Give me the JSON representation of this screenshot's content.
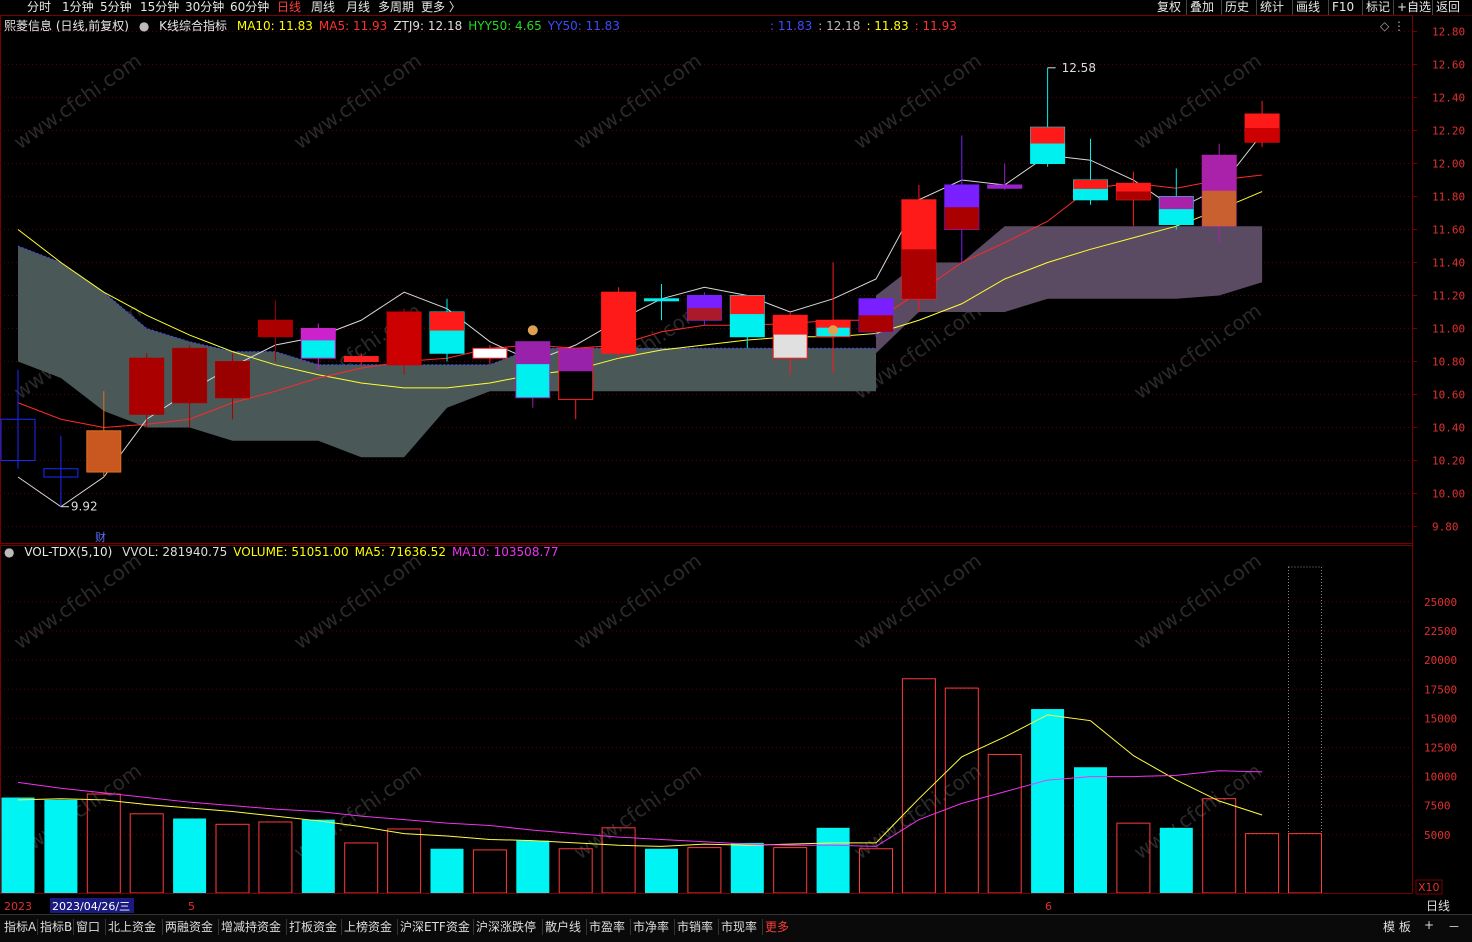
{
  "toolbar": {
    "periods": [
      "分时",
      "1分钟",
      "5分钟",
      "15分钟",
      "30分钟",
      "60分钟",
      "日线",
      "周线",
      "月线",
      "多周期",
      "更多 〉"
    ],
    "active_period": "日线",
    "tools": [
      "复权",
      "叠加",
      "历史",
      "统计",
      "画线",
      "F10",
      "标记",
      "+自选",
      "返回"
    ]
  },
  "main_legend": {
    "stock": "熙菱信息 (日线,前复权)",
    "indicator": "K线综合指标",
    "items": [
      {
        "label": "MA10: 11.83",
        "color": "#ffff00"
      },
      {
        "label": "MA5: 11.93",
        "color": "#ff3030"
      },
      {
        "label": "ZTJ9: 12.18",
        "color": "#dddddd"
      },
      {
        "label": "HYY50: 4.65",
        "color": "#22dd22"
      },
      {
        "label": "YY50: 11.83",
        "color": "#3a4cff"
      }
    ],
    "center_values": [
      {
        "label": ": 11.83",
        "color": "#3a4cff"
      },
      {
        "label": ": 12.18",
        "color": "#bbbbbb"
      },
      {
        "label": ": 11.83",
        "color": "#ffff00"
      },
      {
        "label": ": 11.93",
        "color": "#ff3030"
      }
    ],
    "high_label": "12.58",
    "low_label": "9.92",
    "marker_label": "财"
  },
  "vol_legend": {
    "name": "VOL-TDX(5,10)",
    "items": [
      {
        "label": "VVOL: 281940.75",
        "color": "#dddddd"
      },
      {
        "label": "VOLUME: 51051.00",
        "color": "#ffff00"
      },
      {
        "label": "MA5: 71636.52",
        "color": "#ffff00"
      },
      {
        "label": "MA10: 103508.77",
        "color": "#ee33ee"
      }
    ]
  },
  "price_axis": [
    "12.80",
    "12.60",
    "12.40",
    "12.20",
    "12.00",
    "11.80",
    "11.60",
    "11.40",
    "11.20",
    "11.00",
    "10.80",
    "10.60",
    "10.40",
    "10.20",
    "10.00",
    "9.80"
  ],
  "volume_axis": [
    "25000",
    "22500",
    "20000",
    "17500",
    "15000",
    "12500",
    "10000",
    "7500",
    "5000"
  ],
  "volume_unit": "X10",
  "time_axis": {
    "year": "2023",
    "date": "2023/04/26/三",
    "month5": "5",
    "month6": "6",
    "period": "日线"
  },
  "bottom_tabs": [
    "指标A",
    "指标B",
    "窗口",
    "北上资金",
    "两融资金",
    "增减持资金",
    "打板资金",
    "上榜资金",
    "沪深ETF资金",
    "沪深涨跌停",
    "散户线",
    "市盈率",
    "市净率",
    "市销率",
    "市现率",
    "更多"
  ],
  "bottom_right": {
    "template": "模 板",
    "plus": "+",
    "minus": "－"
  },
  "watermark": "www.cfchi.com",
  "chart_data": {
    "type": "candlestick",
    "price_ylim": [
      9.7,
      12.9
    ],
    "volume_ylim": [
      0,
      28000
    ],
    "candles": [
      {
        "o": 10.45,
        "h": 10.75,
        "l": 10.15,
        "c": 10.2,
        "col": "#1a2aff",
        "fill": "none"
      },
      {
        "o": 10.1,
        "h": 10.35,
        "l": 9.92,
        "c": 10.15,
        "col": "#1a2aff",
        "fill": "none"
      },
      {
        "o": 10.13,
        "h": 10.62,
        "l": 10.1,
        "c": 10.38,
        "col": "#e07020",
        "fill": "#c85820"
      },
      {
        "o": 10.48,
        "h": 10.85,
        "l": 10.4,
        "c": 10.82,
        "col": "#aa0000",
        "fill": "#aa0000"
      },
      {
        "o": 10.55,
        "h": 10.9,
        "l": 10.4,
        "c": 10.88,
        "col": "#aa0000",
        "fill": "#990000"
      },
      {
        "o": 10.58,
        "h": 10.85,
        "l": 10.45,
        "c": 10.8,
        "col": "#aa0000",
        "fill": "#990000"
      },
      {
        "o": 10.95,
        "h": 11.17,
        "l": 10.8,
        "c": 11.05,
        "col": "#aa0000",
        "fill": "#aa0000"
      },
      {
        "o": 10.82,
        "h": 11.03,
        "l": 10.75,
        "c": 11.0,
        "col": "#cc22cc",
        "fill": "#00f0f0",
        "split": true
      },
      {
        "o": 10.8,
        "h": 10.85,
        "l": 10.78,
        "c": 10.83,
        "col": "#ff2020",
        "fill": "#ff2020"
      },
      {
        "o": 10.78,
        "h": 11.12,
        "l": 10.72,
        "c": 11.1,
        "col": "#cc0000",
        "fill": "#cc0000"
      },
      {
        "o": 10.85,
        "h": 11.18,
        "l": 10.8,
        "c": 11.1,
        "col": "#00f0f0",
        "fill": "#00f0f0",
        "top": "#ff1a1a"
      },
      {
        "o": 10.82,
        "h": 10.9,
        "l": 10.78,
        "c": 10.88,
        "col": "#ff2020",
        "fill": "#ffffff"
      },
      {
        "o": 10.58,
        "h": 10.92,
        "l": 10.52,
        "c": 10.92,
        "col": "#9922aa",
        "fill": "#00f0f0",
        "split": true
      },
      {
        "o": 10.57,
        "h": 10.88,
        "l": 10.45,
        "c": 10.88,
        "col": "#ff1a1a",
        "fill": "#000000",
        "top": "#9922aa"
      },
      {
        "o": 10.85,
        "h": 11.25,
        "l": 10.82,
        "c": 11.22,
        "col": "#ff1a1a",
        "fill": "#ff1a1a"
      },
      {
        "o": 11.17,
        "h": 11.27,
        "l": 11.05,
        "c": 11.18,
        "col": "#00f0f0",
        "fill": "#00f0f0"
      },
      {
        "o": 11.05,
        "h": 11.22,
        "l": 11.02,
        "c": 11.2,
        "col": "#7a1fff",
        "fill": "#7a1fff",
        "bottom": "#aa1a2a"
      },
      {
        "o": 10.95,
        "h": 11.2,
        "l": 10.88,
        "c": 11.2,
        "col": "#00f0f0",
        "fill": "#00f0f0",
        "top": "#ff1a1a"
      },
      {
        "o": 10.82,
        "h": 11.1,
        "l": 10.72,
        "c": 11.08,
        "col": "#ff1a1a",
        "fill": "#e0e0e0",
        "top": "#ff1a1a"
      },
      {
        "o": 10.95,
        "h": 11.4,
        "l": 10.73,
        "c": 11.05,
        "col": "#ff1a1a",
        "fill": "#00f0f0",
        "top": "#ff1a1a"
      },
      {
        "o": 10.98,
        "h": 11.15,
        "l": 10.95,
        "c": 11.18,
        "col": "#7a1fff",
        "fill": "#7a1fff",
        "bottom": "#aa0000"
      },
      {
        "o": 11.18,
        "h": 11.87,
        "l": 11.1,
        "c": 11.78,
        "col": "#ff1a1a",
        "fill": "#ff1a1a",
        "bottom": "#aa0000"
      },
      {
        "o": 11.6,
        "h": 12.17,
        "l": 11.4,
        "c": 11.87,
        "col": "#7a1fff",
        "fill": "#7a1fff",
        "bottom": "#aa0000"
      },
      {
        "o": 11.85,
        "h": 12.0,
        "l": 11.84,
        "c": 11.87,
        "col": "#9922cc",
        "fill": "#9922cc"
      },
      {
        "o": 12.0,
        "h": 12.58,
        "l": 11.98,
        "c": 12.22,
        "col": "#00f0f0",
        "fill": "#00f0f0",
        "top": "#ff1a1a"
      },
      {
        "o": 11.78,
        "h": 12.15,
        "l": 11.75,
        "c": 11.9,
        "col": "#00f0f0",
        "fill": "#00f0f0",
        "top": "#ff1a1a"
      },
      {
        "o": 11.78,
        "h": 11.95,
        "l": 11.62,
        "c": 11.88,
        "col": "#ff1a1a",
        "fill": "#ff1a1a",
        "bottom": "#aa0000"
      },
      {
        "o": 11.63,
        "h": 11.97,
        "l": 11.6,
        "c": 11.8,
        "col": "#00f0f0",
        "fill": "#00f0f0",
        "top": "#aa22aa"
      },
      {
        "o": 11.62,
        "h": 12.12,
        "l": 11.52,
        "c": 12.05,
        "col": "#aa22aa",
        "fill": "#aa22aa",
        "bottom": "#c86030"
      },
      {
        "o": 12.13,
        "h": 12.38,
        "l": 12.1,
        "c": 12.3,
        "col": "#ff1a1a",
        "fill": "#ff1a1a",
        "bottom": "#cc0000"
      }
    ],
    "volumes": [
      {
        "v": 8200,
        "up": false
      },
      {
        "v": 8000,
        "up": false
      },
      {
        "v": 8500,
        "up": true
      },
      {
        "v": 6800,
        "up": true
      },
      {
        "v": 6400,
        "up": false
      },
      {
        "v": 5900,
        "up": true
      },
      {
        "v": 6100,
        "up": true
      },
      {
        "v": 6300,
        "up": false
      },
      {
        "v": 4300,
        "up": true
      },
      {
        "v": 5500,
        "up": true
      },
      {
        "v": 3800,
        "up": false
      },
      {
        "v": 3700,
        "up": true
      },
      {
        "v": 4500,
        "up": false
      },
      {
        "v": 3800,
        "up": true
      },
      {
        "v": 5600,
        "up": true
      },
      {
        "v": 3800,
        "up": false
      },
      {
        "v": 3900,
        "up": true
      },
      {
        "v": 4300,
        "up": false
      },
      {
        "v": 3900,
        "up": true
      },
      {
        "v": 5600,
        "up": false
      },
      {
        "v": 3800,
        "up": true
      },
      {
        "v": 18400,
        "up": true
      },
      {
        "v": 17600,
        "up": true
      },
      {
        "v": 11900,
        "up": true
      },
      {
        "v": 15800,
        "up": false
      },
      {
        "v": 10800,
        "up": false
      },
      {
        "v": 6000,
        "up": true
      },
      {
        "v": 5600,
        "up": false
      },
      {
        "v": 8100,
        "up": true
      },
      {
        "v": 5100,
        "up": true
      },
      {
        "v": 28000,
        "up": true,
        "ghost": true
      }
    ],
    "ma5_vol": [
      8000,
      8100,
      8000,
      7600,
      7300,
      7000,
      6600,
      6200,
      5700,
      5100,
      4900,
      4600,
      4500,
      4300,
      4100,
      4000,
      4200,
      4100,
      4200,
      4300,
      4300,
      8100,
      11700,
      13400,
      15300,
      14800,
      11800,
      9700,
      7900,
      6700
    ],
    "ma10_vol": [
      9500,
      9000,
      8600,
      8200,
      7800,
      7500,
      7200,
      7000,
      6600,
      6300,
      6000,
      5800,
      5400,
      5100,
      4800,
      4600,
      4400,
      4200,
      4100,
      4100,
      4000,
      6300,
      7700,
      8700,
      9700,
      10000,
      10000,
      10100,
      10500,
      10400
    ],
    "ma5_price": [
      10.55,
      10.45,
      10.4,
      10.42,
      10.45,
      10.55,
      10.62,
      10.7,
      10.76,
      10.8,
      10.82,
      10.88,
      10.9,
      10.88,
      10.9,
      10.98,
      11.02,
      11.02,
      11.03,
      11.05,
      11.05,
      11.22,
      11.4,
      11.52,
      11.65,
      11.85,
      11.88,
      11.85,
      11.9,
      11.93
    ],
    "ma10_price": [
      11.6,
      11.4,
      11.22,
      11.08,
      10.96,
      10.86,
      10.78,
      10.72,
      10.67,
      10.64,
      10.64,
      10.67,
      10.72,
      10.75,
      10.82,
      10.87,
      10.9,
      10.93,
      10.95,
      10.95,
      10.97,
      11.05,
      11.15,
      11.3,
      11.4,
      11.48,
      11.55,
      11.62,
      11.72,
      11.83
    ],
    "ztj9": [
      10.1,
      9.92,
      10.1,
      10.45,
      10.62,
      10.77,
      10.9,
      10.95,
      11.05,
      11.22,
      11.12,
      10.92,
      10.8,
      10.9,
      11.05,
      11.18,
      11.25,
      11.2,
      11.1,
      11.18,
      11.3,
      11.78,
      11.9,
      11.87,
      12.05,
      12.02,
      11.9,
      11.72,
      11.85,
      12.18
    ],
    "band_upper": [
      11.5,
      11.4,
      11.22,
      11.0,
      10.92,
      10.86,
      10.86,
      10.78,
      10.78,
      10.78,
      10.78,
      10.78,
      10.88,
      10.88,
      10.88,
      10.88,
      10.88,
      10.88,
      10.88,
      10.88,
      10.88,
      11.2,
      11.4,
      11.4,
      11.62,
      11.62,
      11.62,
      11.62,
      11.62,
      11.62
    ],
    "band_lower": [
      10.8,
      10.7,
      10.5,
      10.4,
      10.4,
      10.32,
      10.32,
      10.32,
      10.22,
      10.22,
      10.52,
      10.62,
      10.62,
      10.62,
      10.62,
      10.62,
      10.62,
      10.62,
      10.62,
      10.62,
      10.62,
      11.0,
      11.1,
      11.1,
      11.18,
      11.18,
      11.18,
      11.18,
      11.18,
      11.18
    ],
    "band2_upper": [
      11.2,
      11.4,
      11.4,
      11.62,
      11.62,
      11.62,
      11.62,
      11.62,
      11.62,
      11.62
    ],
    "band2_lower": [
      10.85,
      11.1,
      11.1,
      11.1,
      11.18,
      11.18,
      11.18,
      11.18,
      11.2,
      11.28
    ]
  }
}
